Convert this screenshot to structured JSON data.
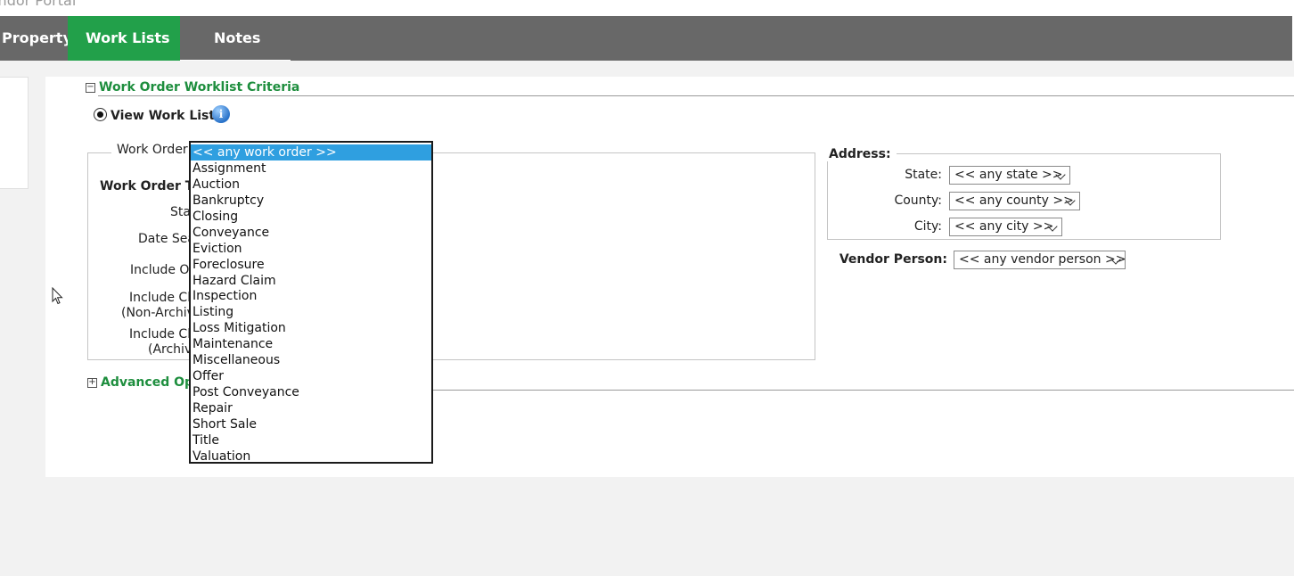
{
  "portal_title": "Vendor Portal",
  "nav": {
    "tabs": [
      {
        "label": "Property",
        "active": false
      },
      {
        "label": "Work Lists",
        "active": true
      },
      {
        "label": "Notes",
        "active": false
      }
    ]
  },
  "criteria": {
    "section_title": "Work Order Worklist Criteria",
    "collapse_symbol": "−",
    "radio_label": "View Work Lists",
    "info_symbol": "i",
    "work_order_label": "Work Order:",
    "left_labels": {
      "work_order_type": "Work Order Type",
      "status": "Status",
      "date_search": "Date Search",
      "include_open": "Include Open",
      "include_closed_non_archived_1": "Include Closed",
      "include_closed_non_archived_2": "(Non-Archived)",
      "include_closed_archived_1": "Include Closed",
      "include_closed_archived_2": "(Archived)"
    },
    "address_legend": "Address:",
    "state_label": "State:",
    "state_value": "<< any state >>",
    "county_label": "County:",
    "county_value": "<< any county >>",
    "city_label": "City:",
    "city_value": "<< any city >>",
    "vendor_label": "Vendor Person:",
    "vendor_value": "<< any vendor person >>",
    "advanced_title": "Advanced Options",
    "expand_symbol": "+"
  },
  "work_order_dropdown": {
    "selected": "<< any work order >>",
    "options": [
      "<< any work order >>",
      "Assignment",
      "Auction",
      "Bankruptcy",
      "Closing",
      "Conveyance",
      "Eviction",
      "Foreclosure",
      "Hazard Claim",
      "Inspection",
      "Listing",
      "Loss Mitigation",
      "Maintenance",
      "Miscellaneous",
      "Offer",
      "Post Conveyance",
      "Repair",
      "Short Sale",
      "Title",
      "Valuation"
    ]
  },
  "colors": {
    "accent_green": "#22a04a",
    "nav_gray": "#686868",
    "selection_blue": "#2f9fe0"
  }
}
